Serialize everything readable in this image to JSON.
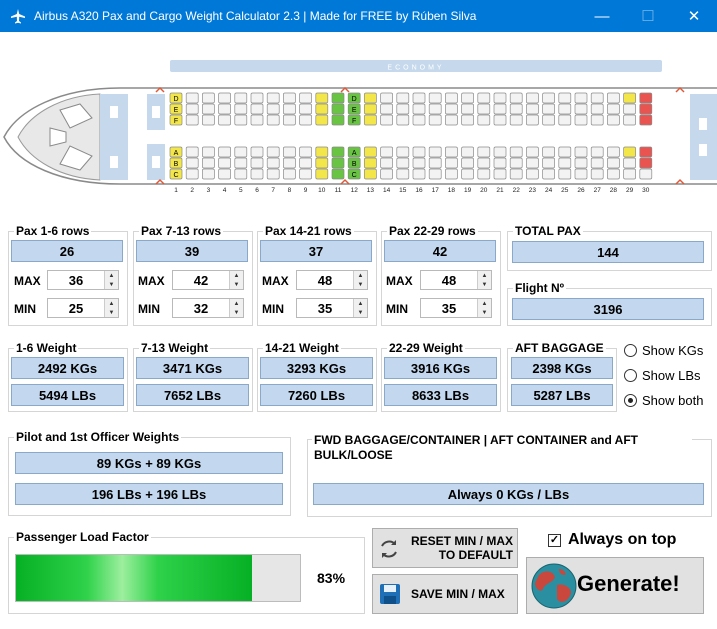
{
  "window": {
    "title": "Airbus A320 Pax and Cargo Weight Calculator 2.3 | Made for FREE by Rúben Silva",
    "minimize": "—",
    "maximize": "☐",
    "close": "✕"
  },
  "seatmap": {
    "cabin_label": "ECONOMY",
    "row_numbers": [
      "1",
      "2",
      "3",
      "4",
      "5",
      "6",
      "7",
      "8",
      "9",
      "10",
      "11",
      "12",
      "13",
      "14",
      "15",
      "16",
      "17",
      "18",
      "19",
      "20",
      "21",
      "22",
      "23",
      "24",
      "25",
      "26",
      "27",
      "28",
      "29",
      "30"
    ],
    "left_letters": "DEF",
    "right_letters": "ABC",
    "colors": {
      "cabin": "#c5d8ec",
      "seat": "#f3f3f3",
      "yellow": "#f2e64a",
      "green": "#69c444",
      "red": "#e95450",
      "exit": "#e05a3a"
    }
  },
  "pax": {
    "groups": [
      {
        "title": "Pax 1-6 rows",
        "value": "26",
        "max_label": "MAX",
        "max": "36",
        "min_label": "MIN",
        "min": "25"
      },
      {
        "title": "Pax 7-13 rows",
        "value": "39",
        "max_label": "MAX",
        "max": "42",
        "min_label": "MIN",
        "min": "32"
      },
      {
        "title": "Pax 14-21 rows",
        "value": "37",
        "max_label": "MAX",
        "max": "48",
        "min_label": "MIN",
        "min": "35"
      },
      {
        "title": "Pax 22-29 rows",
        "value": "42",
        "max_label": "MAX",
        "max": "48",
        "min_label": "MIN",
        "min": "35"
      }
    ],
    "total_title": "TOTAL PAX",
    "total": "144",
    "flight_title": "Flight Nº",
    "flight": "3196"
  },
  "weights": {
    "groups": [
      {
        "title": "1-6 Weight",
        "kg": "2492 KGs",
        "lb": "5494 LBs"
      },
      {
        "title": "7-13 Weight",
        "kg": "3471 KGs",
        "lb": "7652 LBs"
      },
      {
        "title": "14-21 Weight",
        "kg": "3293 KGs",
        "lb": "7260 LBs"
      },
      {
        "title": "22-29 Weight",
        "kg": "3916 KGs",
        "lb": "8633 LBs"
      },
      {
        "title": "AFT BAGGAGE",
        "kg": "2398 KGs",
        "lb": "5287 LBs"
      }
    ]
  },
  "units": {
    "options": [
      "Show KGs",
      "Show LBs",
      "Show both"
    ],
    "selected": "Show both"
  },
  "pilots": {
    "title": "Pilot and 1st Officer Weights",
    "kg": "89 KGs + 89 KGs",
    "lb": "196 LBs + 196 LBs"
  },
  "cargo": {
    "title": "FWD BAGGAGE/CONTAINER | AFT CONTAINER and AFT BULK/LOOSE",
    "value": "Always 0 KGs / LBs"
  },
  "load": {
    "title": "Passenger Load Factor",
    "percent_label": "83%",
    "fraction": 0.83
  },
  "actions": {
    "reset": "RESET MIN / MAX TO DEFAULT",
    "save": "SAVE MIN / MAX",
    "always_on_top": "Always on top",
    "always_on_top_checked": true,
    "generate": "Generate!"
  }
}
